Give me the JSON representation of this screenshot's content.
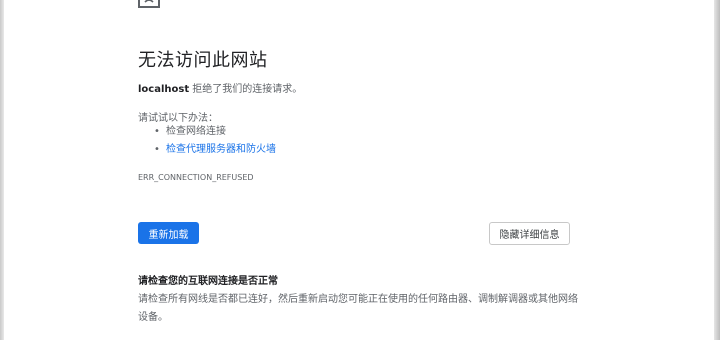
{
  "error_page": {
    "title": "无法访问此网站",
    "host": "localhost",
    "refused_text": " 拒绝了我们的连接请求。",
    "try_label": "请试试以下办法：",
    "suggestions": [
      {
        "text": "检查网络连接",
        "link": false
      },
      {
        "text": "检查代理服务器和防火墙",
        "link": true
      }
    ],
    "bullet": "•",
    "error_code": "ERR_CONNECTION_REFUSED",
    "reload_label": "重新加载",
    "details_label": "隐藏详细信息",
    "check_heading": "请检查您的互联网连接是否正常",
    "check_body": "请检查所有网线是否都已连好，然后重新启动您可能正在使用的任何路由器、调制解调器或其他网络设备。"
  },
  "colors": {
    "accent": "#1a73e8",
    "text_primary": "#202124",
    "text_secondary": "#5f6368"
  },
  "icons": {
    "sad_page": "sad-page-icon"
  }
}
